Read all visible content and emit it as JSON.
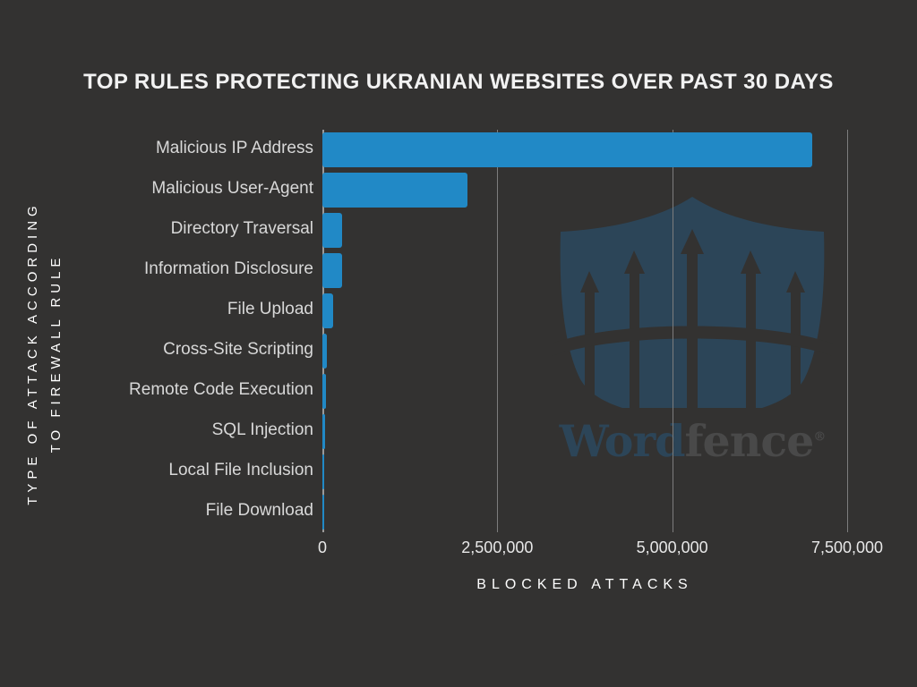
{
  "chart_data": {
    "type": "bar",
    "orientation": "horizontal",
    "title": "TOP RULES PROTECTING UKRANIAN WEBSITES OVER PAST 30 DAYS",
    "xlabel": "BLOCKED ATTACKS",
    "ylabel_line1": "TYPE OF ATTACK ACCORDING",
    "ylabel_line2": "TO FIREWALL RULE",
    "categories": [
      "Malicious IP Address",
      "Malicious User-Agent",
      "Directory Traversal",
      "Information Disclosure",
      "File Upload",
      "Cross-Site Scripting",
      "Remote Code Execution",
      "SQL Injection",
      "Local File Inclusion",
      "File Download"
    ],
    "values": [
      7000000,
      2070000,
      280000,
      280000,
      155000,
      60000,
      55000,
      40000,
      30000,
      25000
    ],
    "xlim": [
      0,
      7500000
    ],
    "xticks": [
      0,
      2500000,
      5000000,
      7500000
    ],
    "xtick_labels": [
      "0",
      "2,500,000",
      "5,000,000",
      "7,500,000"
    ],
    "grid": "vertical",
    "legend": "none",
    "bar_color": "#2189c6",
    "background_color": "#333231",
    "text_color": "#e8e8e8"
  },
  "watermark": {
    "name": "wordfence-logo",
    "word_part": "Word",
    "fence_part": "fence",
    "registered_mark": "®",
    "shield_color": "#2c4558",
    "fence_color": "#333231"
  }
}
